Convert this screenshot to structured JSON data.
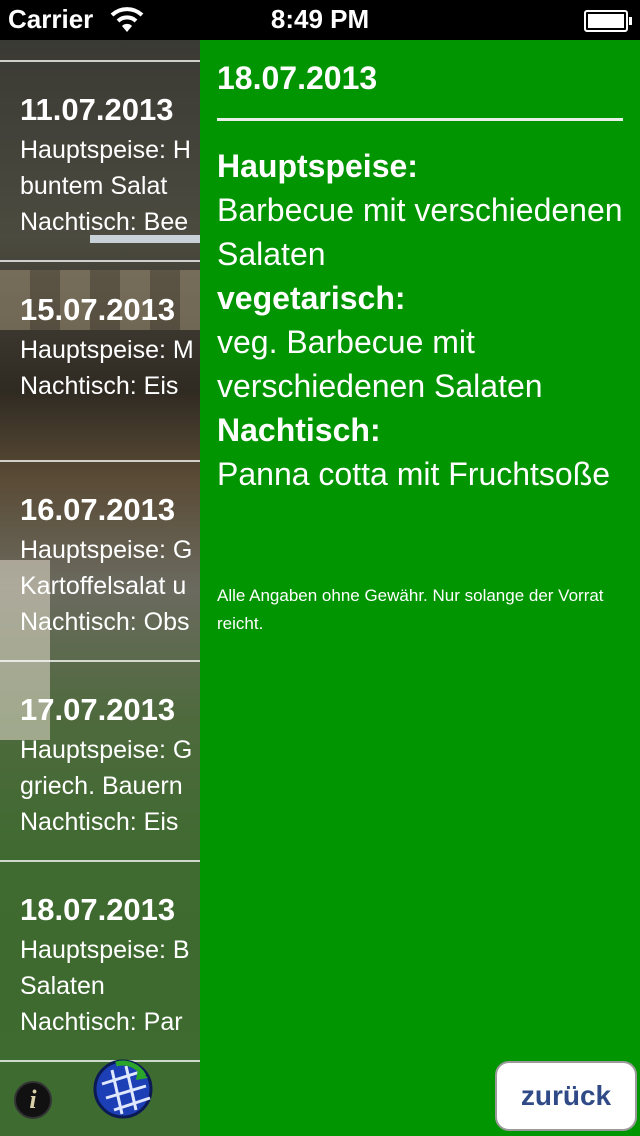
{
  "status_bar": {
    "carrier": "Carrier",
    "time": "8:49 PM"
  },
  "menu_list": [
    {
      "date": "11.07.2013",
      "lines": [
        "Hauptspeise: H",
        "buntem Salat",
        "Nachtisch: Bee"
      ]
    },
    {
      "date": "15.07.2013",
      "lines": [
        "Hauptspeise: M",
        "Nachtisch: Eis",
        ""
      ]
    },
    {
      "date": "16.07.2013",
      "lines": [
        "Hauptspeise: G",
        "Kartoffelsalat u",
        "Nachtisch: Obs"
      ]
    },
    {
      "date": "17.07.2013",
      "lines": [
        "Hauptspeise: G",
        "griech. Bauern",
        "Nachtisch: Eis"
      ]
    },
    {
      "date": "18.07.2013",
      "lines": [
        "Hauptspeise: B",
        "Salaten",
        "Nachtisch: Par"
      ]
    }
  ],
  "toolbar": {
    "info_icon": "i"
  },
  "detail": {
    "date": "18.07.2013",
    "main_label": "Hauptspeise:",
    "main_text": "Barbecue mit verschiedenen Salaten",
    "veg_label": "vegetarisch:",
    "veg_text": "veg. Barbecue mit verschiedenen Salaten",
    "dessert_label": "Nachtisch:",
    "dessert_text": "Panna cotta mit Fruchtsoße",
    "disclaimer": "Alle Angaben ohne Gewähr. Nur solange der Vorrat reicht.",
    "back_label": "zurück"
  },
  "colors": {
    "panel_bg": "#019501",
    "back_text": "#2f4a86"
  }
}
